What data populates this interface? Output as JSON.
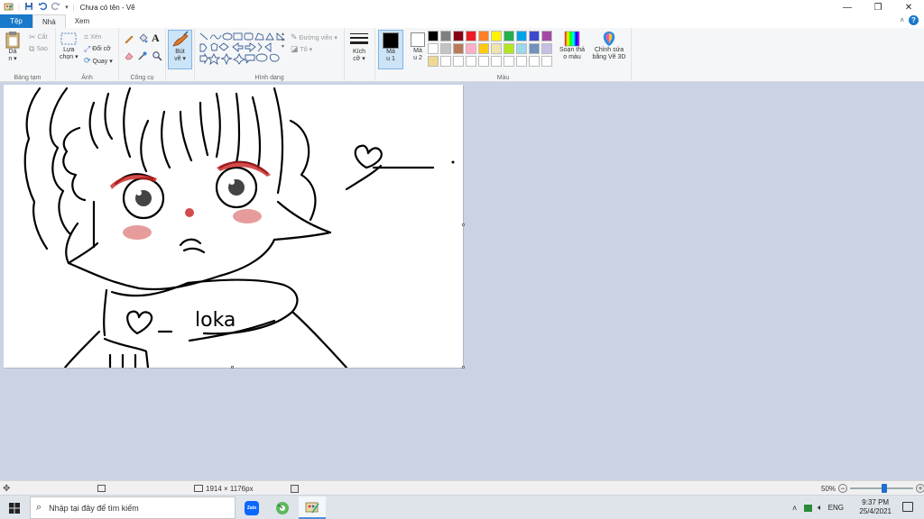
{
  "window": {
    "title": "Chưa có tên - Vẽ",
    "quick_access_dropdown": "▾"
  },
  "tabs": [
    {
      "label": "Tệp"
    },
    {
      "label": "Nhà"
    },
    {
      "label": "Xem"
    }
  ],
  "ribbon": {
    "clipboard": {
      "paste_label_line1": "Dá",
      "paste_label_line2": "n ▾",
      "cut_label": "Cắt",
      "copy_label": "Sao",
      "group_label": "Bảng tạm"
    },
    "image": {
      "select_label_line1": "Lựa",
      "select_label_line2": "chọn ▾",
      "crop_label": "Xén",
      "resize_label": "Đổi cỡ",
      "rotate_label": "Quay ▾",
      "group_label": "Ảnh"
    },
    "tools": {
      "text_tool_glyph": "A",
      "group_label": "Công cụ"
    },
    "brushes": {
      "label_line1": "Bút",
      "label_line2": "vẽ ▾"
    },
    "shapes": {
      "outline_label": "Đường viền ▾",
      "fill_label": "Tô ▾",
      "group_label": "Hình dạng"
    },
    "size": {
      "label_line1": "Kích",
      "label_line2": "cỡ ▾"
    },
    "colors": {
      "color1_line1": "Mà",
      "color1_line2": "u 1",
      "color2_line1": "Mà",
      "color2_line2": "u 2",
      "edit_colors_line1": "Soạn thả",
      "edit_colors_line2": "o màu",
      "paint3d_line1": "Chỉnh sửa",
      "paint3d_line2": "bằng Vẽ 3D",
      "group_label": "Màu",
      "color1": "#000000",
      "color2": "#ffffff",
      "palette_row1": [
        "#000000",
        "#7f7f7f",
        "#880015",
        "#ed1c24",
        "#ff7f27",
        "#fff200",
        "#22b14c",
        "#00a2e8",
        "#3f48cc",
        "#a349a4"
      ],
      "palette_row2": [
        "#ffffff",
        "#c3c3c3",
        "#b97a57",
        "#ffaec9",
        "#ffc90e",
        "#efe4b0",
        "#b5e61d",
        "#99d9ea",
        "#7092be",
        "#c8bfe7"
      ],
      "palette_row3": [
        "#f0d890",
        "#ffffff",
        "#ffffff",
        "#ffffff",
        "#ffffff",
        "#ffffff",
        "#ffffff",
        "#ffffff",
        "#ffffff",
        "#ffffff"
      ]
    }
  },
  "canvas": {
    "drawn_text": "loka"
  },
  "statusbar": {
    "dimensions": "1914 × 1176px",
    "zoom": "50%",
    "zoom_fraction": 0.55
  },
  "taskbar": {
    "search_placeholder": "Nhập tại đây để tìm kiếm",
    "zalo_label": "Zalo",
    "language": "ENG",
    "time": "9:37 PM",
    "date": "25/4/2021"
  }
}
